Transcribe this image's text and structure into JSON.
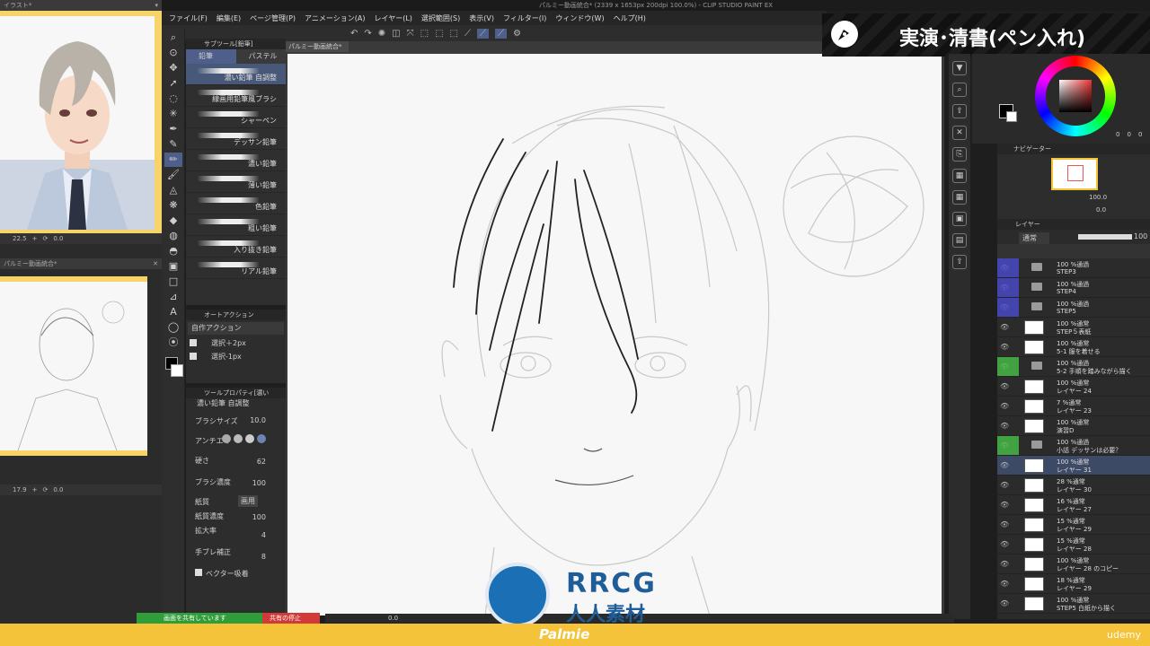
{
  "window": {
    "title": "パルミー動画統合* (2339 x 1653px 200dpi 100.0%) - CLIP STUDIO PAINT EX",
    "menu": [
      "ファイル(F)",
      "編集(E)",
      "ページ管理(P)",
      "アニメーション(A)",
      "レイヤー(L)",
      "選択範囲(S)",
      "表示(V)",
      "フィルター(I)",
      "ウィンドウ(W)",
      "ヘルプ(H)"
    ],
    "canvas_tab": "パルミー動画統合*"
  },
  "banner": {
    "title": "実演･清書(ペン入れ)"
  },
  "preview_top": {
    "tab": "イラスト*",
    "zoom": "22.5",
    "rotation": "0.0"
  },
  "preview_bottom": {
    "tab": "パルミー動画統合*",
    "zoom": "17.9",
    "rotation": "0.0"
  },
  "subtool": {
    "panel_title": "サブツール[鉛筆]",
    "tabs": [
      "鉛筆",
      "パステル"
    ],
    "brushes": [
      "濃い鉛筆 自調整",
      "線画用鉛筆風ブラシ",
      "シャーペン",
      "デッサン鉛筆",
      "濃い鉛筆",
      "薄い鉛筆",
      "色鉛筆",
      "粗い鉛筆",
      "入り抜き鉛筆",
      "リアル鉛筆"
    ]
  },
  "auto_action": {
    "panel_title": "オートアクション",
    "set_name": "自作アクション",
    "items": [
      "選択＋2px",
      "選択-1px"
    ]
  },
  "tool_property": {
    "panel_title": "ツールプロパティ[濃い",
    "brush_name": "濃い鉛筆 自調整",
    "rows": [
      {
        "label": "ブラシサイズ",
        "value": "10.0"
      },
      {
        "label": "アンチエイ",
        "value": ""
      },
      {
        "label": "硬さ",
        "value": "62"
      },
      {
        "label": "ブラシ濃度",
        "value": "100"
      },
      {
        "label": "紙質",
        "value": "画用"
      },
      {
        "label": "紙質濃度",
        "value": "100"
      },
      {
        "label": "拡大率",
        "value": "4"
      },
      {
        "label": "手ブレ補正",
        "value": "8"
      },
      {
        "label": "ベクター吸着",
        "value": ""
      }
    ]
  },
  "navigator": {
    "title": "ナビゲーター",
    "zoom": "100.0",
    "rotation": "0.0"
  },
  "color_values": [
    "0",
    "0",
    "0"
  ],
  "layer_panel": {
    "title": "レイヤー",
    "blend_mode": "通常",
    "opacity": "100",
    "layers": [
      {
        "l1": "100 %通過",
        "l2": "STEP3",
        "kind": "folder",
        "color": "#4b4bd0"
      },
      {
        "l1": "100 %通過",
        "l2": "STEP4",
        "kind": "folder",
        "color": "#4b4bd0"
      },
      {
        "l1": "100 %通過",
        "l2": "STEP5",
        "kind": "folder",
        "color": "#4b4bd0"
      },
      {
        "l1": "100 %通常",
        "l2": "STEP５表紙",
        "kind": "thumb",
        "color": ""
      },
      {
        "l1": "100 %通常",
        "l2": "5-1 服を着せる",
        "kind": "thumb",
        "color": ""
      },
      {
        "l1": "100 %通過",
        "l2": "5-2 手順を踏みながら描く",
        "kind": "folder",
        "color": "#48c048"
      },
      {
        "l1": "100 %通常",
        "l2": "レイヤー 24",
        "kind": "thumb",
        "color": ""
      },
      {
        "l1": "7 %通常",
        "l2": "レイヤー 23",
        "kind": "thumb",
        "color": ""
      },
      {
        "l1": "100 %通常",
        "l2": "演習D",
        "kind": "thumb",
        "color": ""
      },
      {
        "l1": "100 %通過",
        "l2": "小話 デッサンは必要？",
        "kind": "folder",
        "color": "#48c048"
      },
      {
        "l1": "100 %通常",
        "l2": "レイヤー 31",
        "kind": "thumb",
        "color": "",
        "sel": true
      },
      {
        "l1": "28 %通常",
        "l2": "レイヤー 30",
        "kind": "thumb",
        "color": ""
      },
      {
        "l1": "16 %通常",
        "l2": "レイヤー 27",
        "kind": "thumb",
        "color": ""
      },
      {
        "l1": "15 %通常",
        "l2": "レイヤー 29",
        "kind": "thumb",
        "color": ""
      },
      {
        "l1": "15 %通常",
        "l2": "レイヤー 28",
        "kind": "thumb",
        "color": ""
      },
      {
        "l1": "100 %通常",
        "l2": "レイヤー 28 のコピー",
        "kind": "thumb",
        "color": ""
      },
      {
        "l1": "18 %通常",
        "l2": "レイヤー 29",
        "kind": "thumb",
        "color": ""
      },
      {
        "l1": "100 %通常",
        "l2": "STEP5 白紙から描く",
        "kind": "thumb",
        "color": ""
      }
    ]
  },
  "share": {
    "sharing": "画面を共有しています",
    "stop": "共有の停止"
  },
  "status": {
    "zoom": "0.0"
  },
  "watermark": {
    "brand": "RRCG",
    "sub": "人人素材"
  },
  "footer": {
    "logo": "Palmie",
    "udemy": "udemy"
  }
}
